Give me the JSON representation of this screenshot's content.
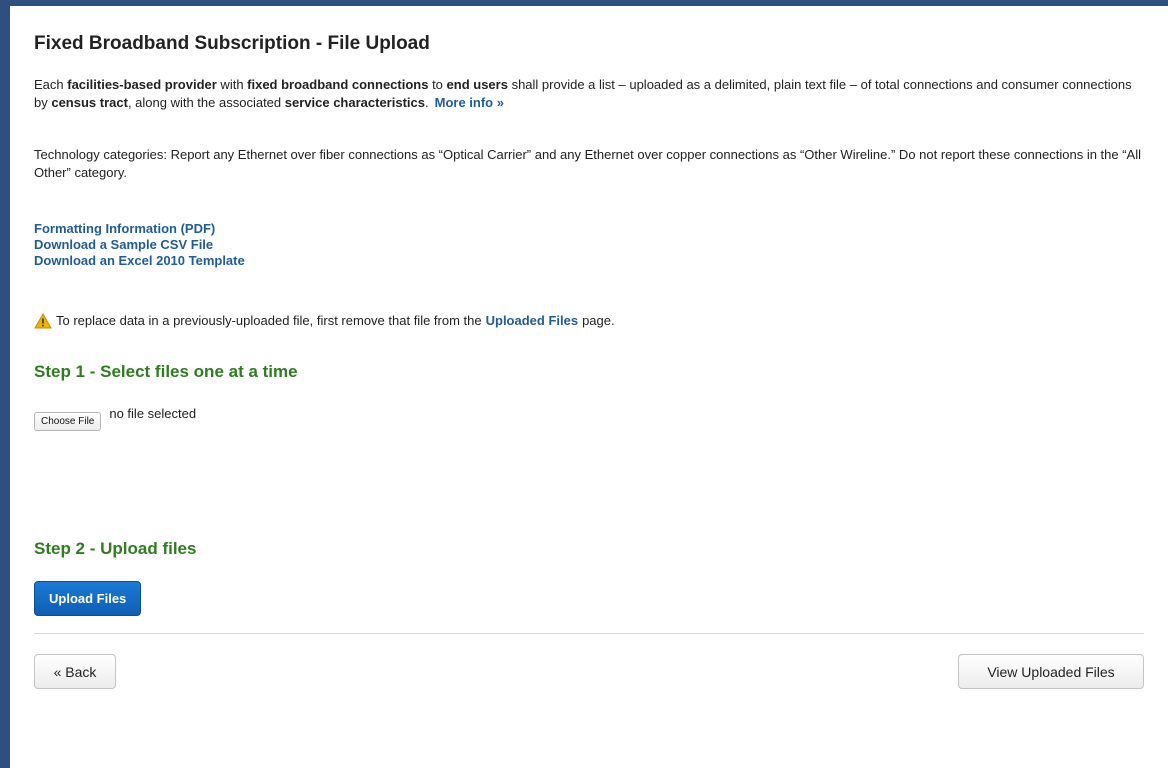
{
  "page": {
    "title": "Fixed Broadband Subscription - File Upload"
  },
  "intro": {
    "t1": "Each ",
    "b1": "facilities-based provider",
    "t2": " with ",
    "b2": "fixed broadband connections",
    "t3": " to ",
    "b3": "end users",
    "t4": " shall provide a list – uploaded as a delimited, plain text file – of total connections and consumer connections by ",
    "b4": "census tract",
    "t5": ", along with the associated ",
    "b5": "service characteristics",
    "t6": ".",
    "more_link": "More info »"
  },
  "technology_note": "Technology categories: Report any Ethernet over fiber connections as “Optical Carrier” and any Ethernet over copper connections as “Other Wireline.” Do not report these connections in the “All Other” category.",
  "links": [
    {
      "label": "Formatting Information (PDF)"
    },
    {
      "label": "Download a Sample CSV File"
    },
    {
      "label": "Download an Excel 2010 Template"
    }
  ],
  "warning": {
    "icon": "warning-icon",
    "before": "To replace data in a previously-uploaded file, first remove that file from the",
    "link": "Uploaded Files",
    "after": "page."
  },
  "step1": {
    "heading": "Step 1 - Select files one at a time",
    "choose_label": "Choose File",
    "file_status": "no file selected"
  },
  "step2": {
    "heading": "Step 2 - Upload files",
    "upload_label": "Upload Files"
  },
  "footer": {
    "back_label": "« Back",
    "view_uploaded_label": "View Uploaded Files"
  },
  "colors": {
    "frame": "#2f4f80",
    "link": "#1f5c99",
    "step_heading": "#2e7d1f",
    "primary_button": "#1a7ad6",
    "warning": "#f0b400"
  }
}
